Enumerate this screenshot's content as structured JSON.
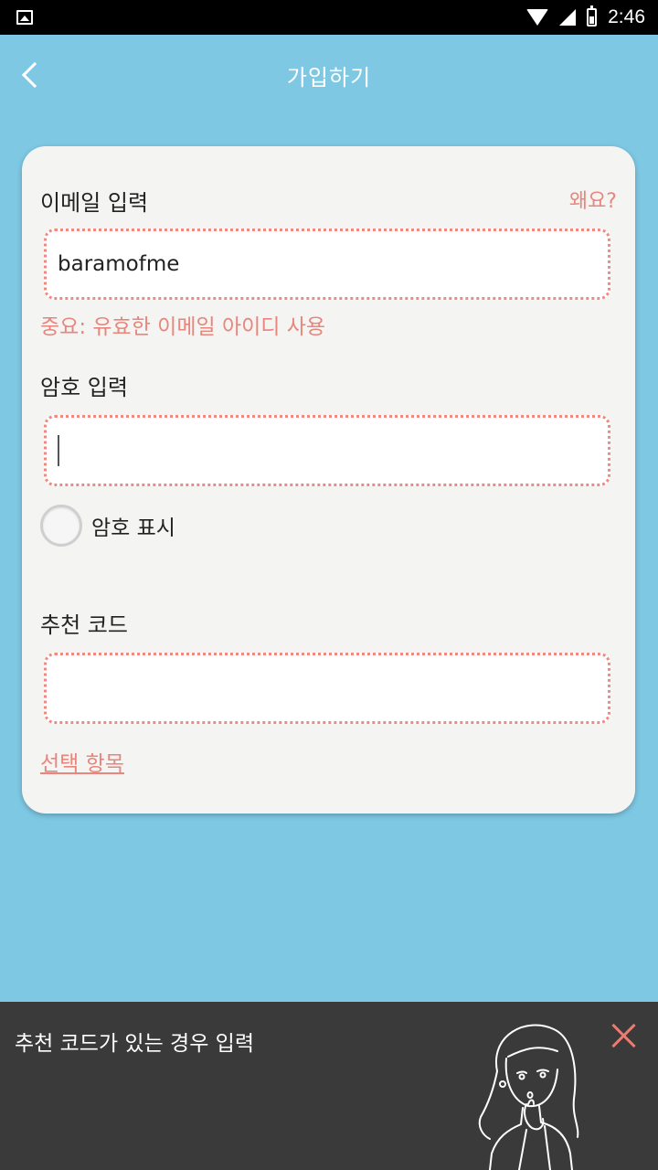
{
  "status_bar": {
    "time": "2:46"
  },
  "header": {
    "title": "가입하기"
  },
  "form": {
    "email_label": "이메일 입력",
    "why_link": "왜요?",
    "email_value": "baramofme",
    "email_hint": "중요: 유효한 이메일 아이디 사용",
    "password_label": "암호 입력",
    "password_value": "",
    "show_password_label": "암호 표시",
    "referral_label": "추천 코드",
    "referral_value": "",
    "optional_link": "선택 항목"
  },
  "tip": {
    "text": "추천 코드가 있는 경우 입력"
  },
  "colors": {
    "background": "#7ec8e3",
    "accent": "#e8857d",
    "card": "#f4f4f2",
    "tip_bar": "#3a3a3a"
  }
}
